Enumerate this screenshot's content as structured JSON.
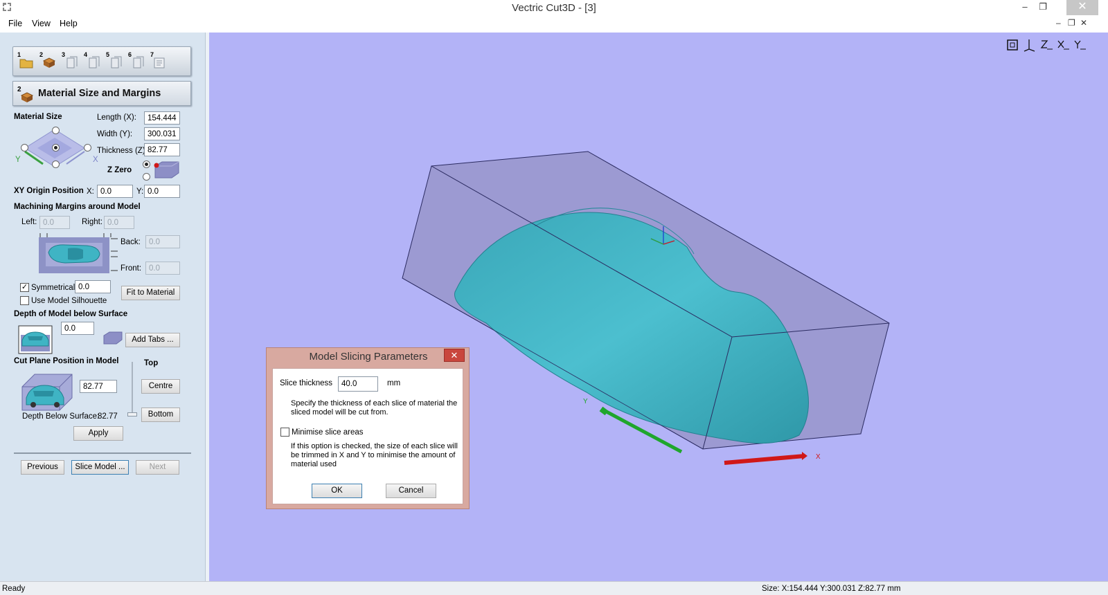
{
  "window": {
    "title": "Vectric Cut3D - [3]"
  },
  "menu": {
    "file": "File",
    "view": "View",
    "help": "Help"
  },
  "steps": [
    "1",
    "2",
    "3",
    "4",
    "5",
    "6",
    "7"
  ],
  "section": {
    "step": "2",
    "title": "Material Size and Margins"
  },
  "material_size": {
    "heading": "Material Size",
    "length_label": "Length (X):",
    "length_value": "154.444",
    "width_label": "Width (Y):",
    "width_value": "300.031",
    "thickness_label": "Thickness (Z):",
    "thickness_value": "82.77",
    "z_zero_label": "Z Zero",
    "axis_x": "X",
    "axis_y": "Y"
  },
  "xy_origin": {
    "label": "XY Origin Position",
    "x_label": "X:",
    "x_value": "0.0",
    "y_label": "Y:",
    "y_value": "0.0"
  },
  "margins": {
    "heading": "Machining Margins around Model",
    "left_label": "Left:",
    "left_value": "0.0",
    "right_label": "Right:",
    "right_value": "0.0",
    "back_label": "Back:",
    "back_value": "0.0",
    "front_label": "Front:",
    "front_value": "0.0",
    "symmetrical_label": "Symmetrical",
    "symmetrical_checked": true,
    "symmetrical_value": "0.0",
    "silhouette_label": "Use Model Silhouette",
    "silhouette_checked": false,
    "fit_button": "Fit to Material"
  },
  "depth": {
    "heading": "Depth of Model below Surface",
    "value": "0.0",
    "add_tabs_button": "Add Tabs ..."
  },
  "cut_plane": {
    "heading": "Cut Plane Position in Model",
    "top_label": "Top",
    "value": "82.77",
    "centre_button": "Centre",
    "bottom_button": "Bottom",
    "depth_below_label": "Depth Below Surface:",
    "depth_below_value": "82.77"
  },
  "apply_button": "Apply",
  "nav": {
    "previous": "Previous",
    "slice": "Slice Model ...",
    "next": "Next"
  },
  "dialog": {
    "title": "Model Slicing Parameters",
    "close": "✕",
    "slice_label": "Slice thickness",
    "slice_value": "40.0",
    "slice_unit": "mm",
    "slice_help_1": "Specify the thickness of each slice of material the",
    "slice_help_2": "sliced model will be cut from.",
    "minimise_label": "Minimise slice areas",
    "minimise_checked": false,
    "minimise_help_1": "If this option is checked, the size of each slice will",
    "minimise_help_2": "be trimmed in X and Y to minimise the amount of",
    "minimise_help_3": "material used",
    "ok": "OK",
    "cancel": "Cancel"
  },
  "status": {
    "left": "Ready",
    "right": "Size: X:154.444 Y:300.031 Z:82.77 mm"
  },
  "colors": {
    "viewport": "#b3b3f7",
    "model": "#3fb4c4",
    "panel": "#d8e4f0",
    "dialog_frame": "#d8a9a0"
  }
}
